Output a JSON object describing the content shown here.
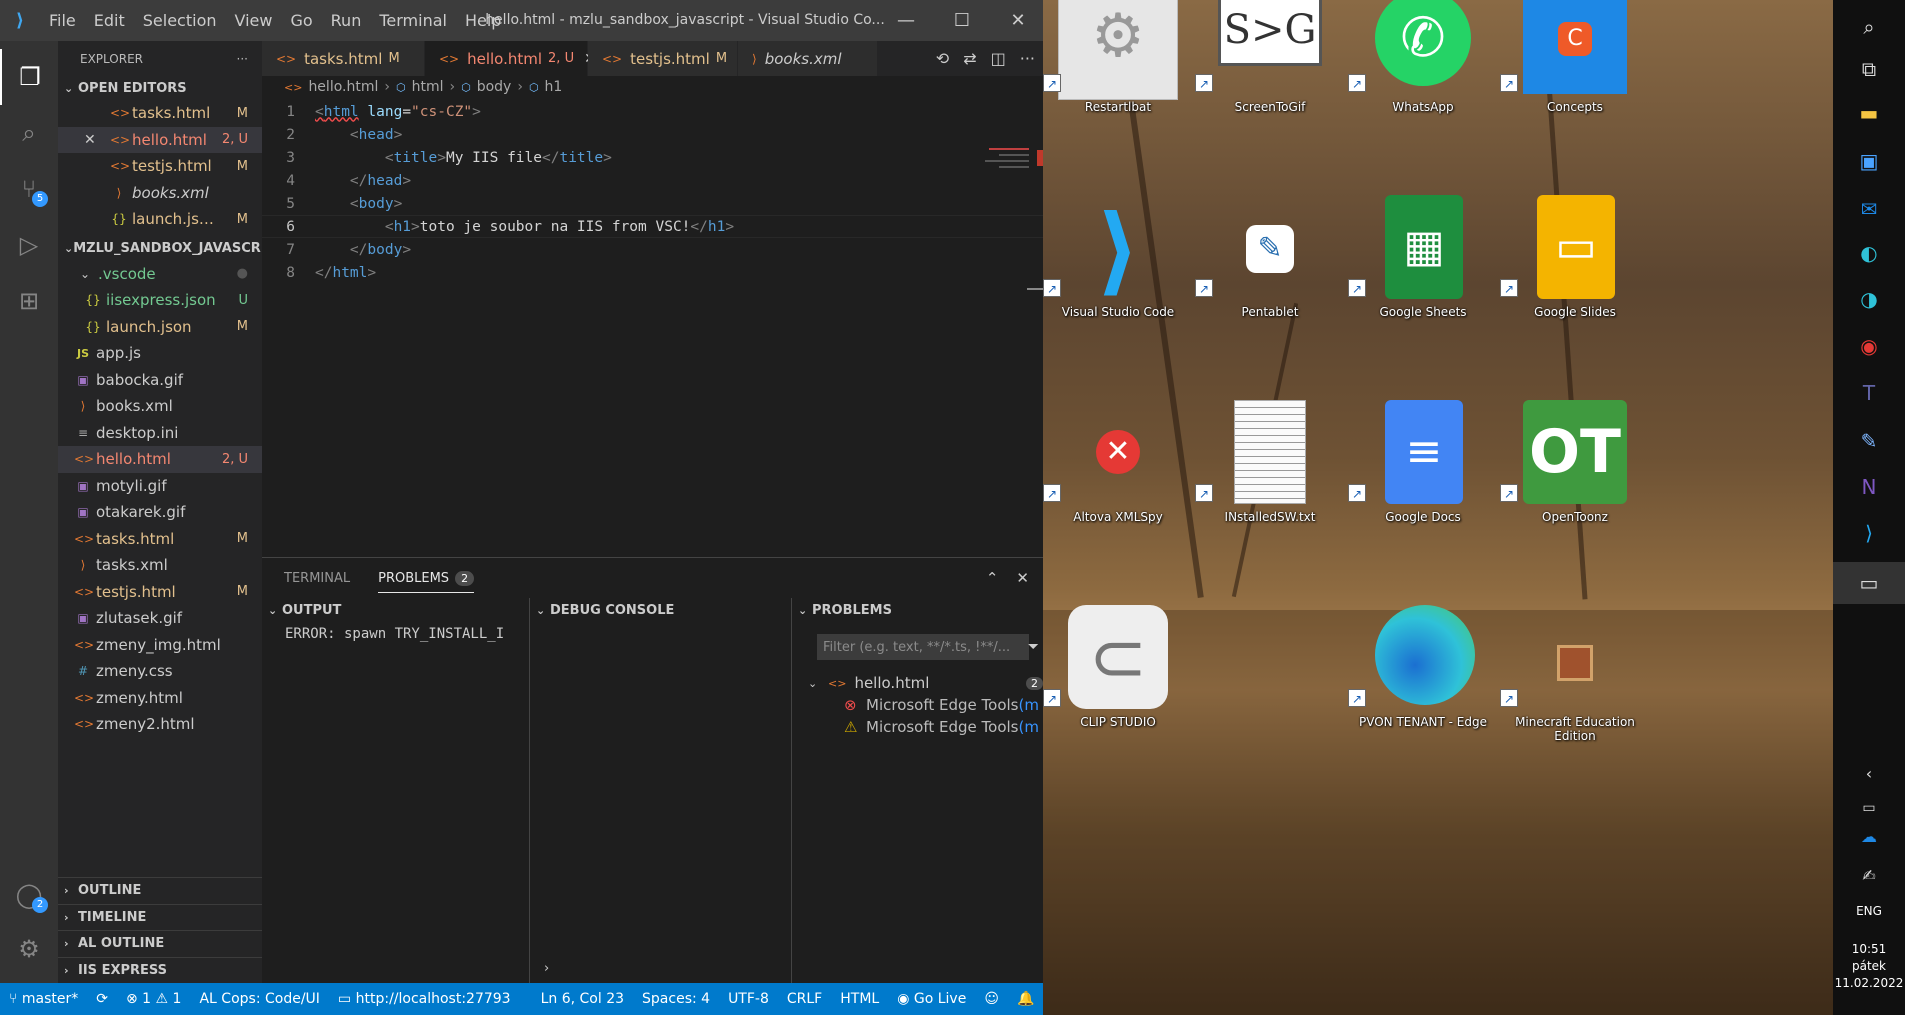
{
  "vscode": {
    "menu": [
      "File",
      "Edit",
      "Selection",
      "View",
      "Go",
      "Run",
      "Terminal",
      "Help"
    ],
    "title": "hello.html - mzlu_sandbox_javascript - Visual Studio Co...",
    "explorer_title": "EXPLORER",
    "open_editors": {
      "title": "OPEN EDITORS",
      "items": [
        {
          "name": "tasks.html",
          "status": "M"
        },
        {
          "name": "hello.html",
          "status": "2, U"
        },
        {
          "name": "testjs.html",
          "status": "M"
        },
        {
          "name": "books.xml",
          "status": ""
        },
        {
          "name": "launch.json...",
          "status": "M"
        }
      ]
    },
    "workspace": {
      "title": "MZLU_SANDBOX_JAVASCR...",
      "items": [
        {
          "name": ".vscode",
          "status": ""
        },
        {
          "name": "iisexpress.json",
          "status": "U"
        },
        {
          "name": "launch.json",
          "status": "M"
        },
        {
          "name": "app.js",
          "status": ""
        },
        {
          "name": "babocka.gif",
          "status": ""
        },
        {
          "name": "books.xml",
          "status": ""
        },
        {
          "name": "desktop.ini",
          "status": ""
        },
        {
          "name": "hello.html",
          "status": "2, U"
        },
        {
          "name": "motyli.gif",
          "status": ""
        },
        {
          "name": "otakarek.gif",
          "status": ""
        },
        {
          "name": "tasks.html",
          "status": "M"
        },
        {
          "name": "tasks.xml",
          "status": ""
        },
        {
          "name": "testjs.html",
          "status": "M"
        },
        {
          "name": "zlutasek.gif",
          "status": ""
        },
        {
          "name": "zmeny_img.html",
          "status": ""
        },
        {
          "name": "zmeny.css",
          "status": ""
        },
        {
          "name": "zmeny.html",
          "status": ""
        },
        {
          "name": "zmeny2.html",
          "status": ""
        }
      ]
    },
    "bottom_sections": [
      "OUTLINE",
      "TIMELINE",
      "AL OUTLINE",
      "IIS EXPRESS"
    ],
    "activity_badges": {
      "scm": "5",
      "accounts": "2"
    },
    "tabs": [
      {
        "name": "tasks.html",
        "status": "M"
      },
      {
        "name": "hello.html",
        "status": "2, U"
      },
      {
        "name": "testjs.html",
        "status": "M"
      },
      {
        "name": "books.xml",
        "status": ""
      }
    ],
    "breadcrumb": [
      "hello.html",
      "html",
      "body",
      "h1"
    ],
    "code": {
      "line_numbers": [
        "1",
        "2",
        "3",
        "4",
        "5",
        "6",
        "7",
        "8"
      ],
      "l1_tag": "html",
      "l1_attr": "lang",
      "l1_val": "\"cs-CZ\"",
      "l2_tag": "head",
      "l3_tag": "title",
      "l3_text": "My IIS file",
      "l4_tag": "head",
      "l5_tag": "body",
      "l6_tag": "h1",
      "l6_text": "toto je soubor na IIS from VSC!",
      "l7_tag": "body",
      "l8_tag": "html"
    },
    "panel": {
      "tabs": [
        "TERMINAL",
        "PROBLEMS"
      ],
      "problems_count": "2",
      "output_title": "OUTPUT",
      "output_text": "ERROR: spawn TRY_INSTALL_I",
      "debug_title": "DEBUG CONSOLE",
      "problems_title": "PROBLEMS",
      "filter_placeholder": "Filter (e.g. text, **/*.ts, !**/...",
      "problem_file": "hello.html",
      "problem_file_count": "2",
      "problems": [
        "Microsoft Edge Tools",
        "Microsoft Edge Tools"
      ]
    },
    "status": {
      "branch": "master*",
      "errors": "1",
      "warnings": "1",
      "alcops": "AL Cops: Code/UI",
      "url": "http://localhost:27793",
      "position": "Ln 6, Col 23",
      "spaces": "Spaces: 4",
      "encoding": "UTF-8",
      "eol": "CRLF",
      "language": "HTML",
      "golive": "Go Live"
    }
  },
  "desktop": {
    "icons": [
      {
        "label": "Restartlbat"
      },
      {
        "label": "ScreenToGif"
      },
      {
        "label": "WhatsApp"
      },
      {
        "label": "Concepts"
      },
      {
        "label": "Visual Studio Code"
      },
      {
        "label": "Pentablet"
      },
      {
        "label": "Google Sheets"
      },
      {
        "label": "Google Slides"
      },
      {
        "label": "Altova XMLSpy"
      },
      {
        "label": "INstalledSW.txt"
      },
      {
        "label": "Google Docs"
      },
      {
        "label": "OpenToonz"
      },
      {
        "label": "CLIP STUDIO"
      },
      {
        "label": "PVON TENANT - Edge"
      },
      {
        "label": "Minecraft Education Edition"
      }
    ],
    "screentogif_text": "S>G"
  },
  "taskbar": {
    "lang": "ENG",
    "time": "10:51",
    "day": "pátek",
    "date": "11.02.2022"
  }
}
